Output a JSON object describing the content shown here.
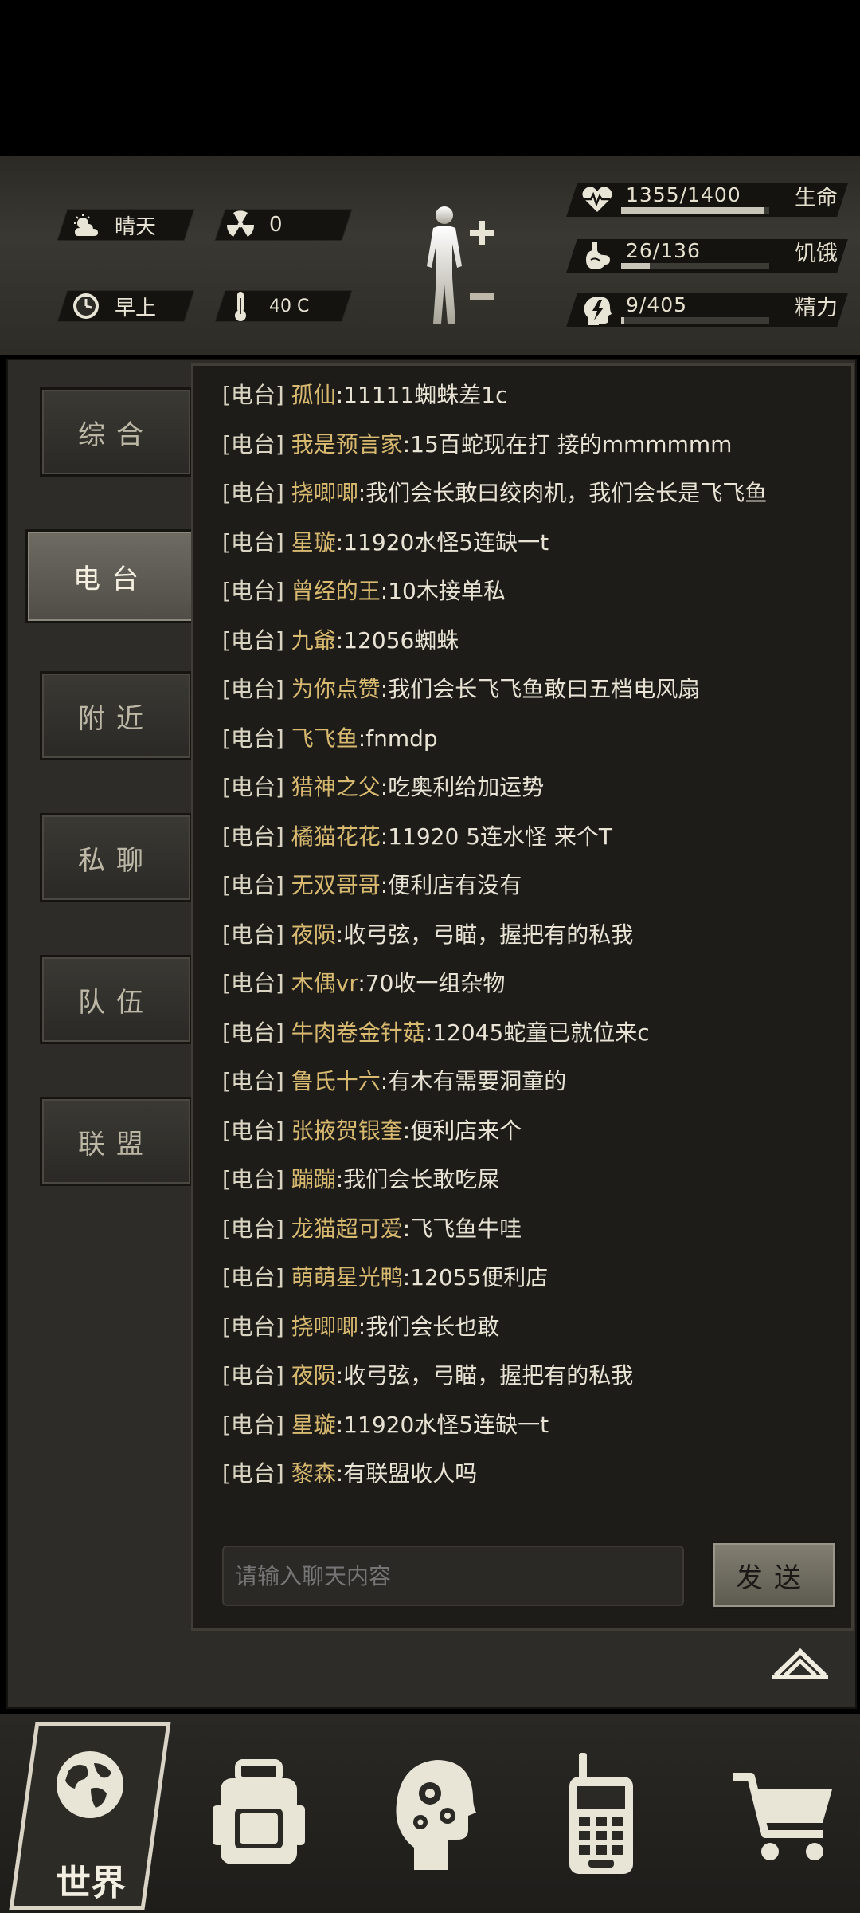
{
  "status": {
    "weather": "晴天",
    "radiation": "0",
    "time_of_day": "早上",
    "temperature": "40 C",
    "stats": [
      {
        "icon": "heartbeat-icon",
        "value": "1355/1400",
        "label": "生命",
        "fraction": 0.968
      },
      {
        "icon": "stomach-icon",
        "value": "26/136",
        "label": "饥饿",
        "fraction": 0.191
      },
      {
        "icon": "brain-energy-icon",
        "value": "9/405",
        "label": "精力",
        "fraction": 0.022
      }
    ]
  },
  "tabs": [
    {
      "label": "综合",
      "active": false
    },
    {
      "label": "电台",
      "active": true
    },
    {
      "label": "附近",
      "active": false
    },
    {
      "label": "私聊",
      "active": false
    },
    {
      "label": "队伍",
      "active": false
    },
    {
      "label": "联盟",
      "active": false
    }
  ],
  "chat": {
    "messages": [
      {
        "channel": "[电台]",
        "name": "孤仙",
        "text": ":11111蜘蛛差1c"
      },
      {
        "channel": "[电台]",
        "name": "我是预言家",
        "text": ":15百蛇现在打 接的mmmmmm"
      },
      {
        "channel": "[电台]",
        "name": "挠唧唧",
        "text": ":我们会长敢曰绞肉机，我们会长是飞飞鱼"
      },
      {
        "channel": "[电台]",
        "name": "星璇",
        "text": ":11920水怪5连缺一t"
      },
      {
        "channel": "[电台]",
        "name": "曾经的王",
        "text": ":10木接单私"
      },
      {
        "channel": "[电台]",
        "name": "九爺",
        "text": ":12056蜘蛛"
      },
      {
        "channel": "[电台]",
        "name": "为你点赞",
        "text": ":我们会长飞飞鱼敢曰五档电风扇"
      },
      {
        "channel": "[电台]",
        "name": "飞飞鱼",
        "text": ":fnmdp"
      },
      {
        "channel": "[电台]",
        "name": "猎神之父",
        "text": ":吃奥利给加运势"
      },
      {
        "channel": "[电台]",
        "name": "橘猫花花",
        "text": ":11920 5连水怪 来个T"
      },
      {
        "channel": "[电台]",
        "name": "无双哥哥",
        "text": ":便利店有没有"
      },
      {
        "channel": "[电台]",
        "name": "夜陨",
        "text": ":收弓弦，弓瞄，握把有的私我"
      },
      {
        "channel": "[电台]",
        "name": "木偶vr",
        "text": ":70收一组杂物"
      },
      {
        "channel": "[电台]",
        "name": "牛肉卷金针菇",
        "text": ":12045蛇童已就位来c"
      },
      {
        "channel": "[电台]",
        "name": "鲁氏十六",
        "text": ":有木有需要洞童的"
      },
      {
        "channel": "[电台]",
        "name": "张掖贺银奎",
        "text": ":便利店来个"
      },
      {
        "channel": "[电台]",
        "name": "蹦蹦",
        "text": ":我们会长敢吃屎"
      },
      {
        "channel": "[电台]",
        "name": "龙猫超可爱",
        "text": ":飞飞鱼牛哇"
      },
      {
        "channel": "[电台]",
        "name": "萌萌星光鸭",
        "text": ":12055便利店"
      },
      {
        "channel": "[电台]",
        "name": "挠唧唧",
        "text": ":我们会长也敢"
      },
      {
        "channel": "[电台]",
        "name": "夜陨",
        "text": ":收弓弦，弓瞄，握把有的私我"
      },
      {
        "channel": "[电台]",
        "name": "星璇",
        "text": ":11920水怪5连缺一t"
      },
      {
        "channel": "[电台]",
        "name": "黎森",
        "text": ":有联盟收人吗"
      }
    ],
    "input_placeholder": "请输入聊天内容",
    "send_label": "发送"
  },
  "nav": {
    "world_label": "世界",
    "items": [
      "backpack-icon",
      "head-gears-icon",
      "walkie-talkie-icon",
      "shopping-cart-icon"
    ]
  }
}
